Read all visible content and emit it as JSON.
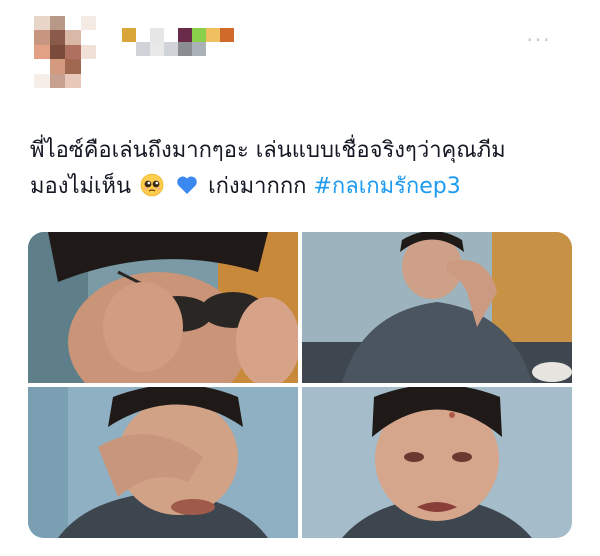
{
  "tweet": {
    "text_line1": "พี่ไอซ์คือเล่นถึงมากๆอะ เล่นแบบเชื่อจริงๆว่าคุณภีม",
    "text_line2_before": "มองไม่เห็น",
    "text_line2_after": "เก่งมากกก",
    "hashtag": "#กลเกมรักep3",
    "emojis": [
      "pleading-face",
      "blue-heart"
    ]
  },
  "colors": {
    "text": "#141823",
    "hashtag": "#1d9bf0",
    "avatar_pixels": [
      "#e8d6c8",
      "#b89988",
      "#ffffff",
      "#f4ece4",
      "#c89680",
      "#8a5a4a",
      "#d9b8a8",
      "#ffffff",
      "#e2a084",
      "#7a4a3a",
      "#b07060",
      "#f0e0d8",
      "#ffffff",
      "#d49a80",
      "#a06850",
      "#ffffff",
      "#f6eee8",
      "#c8a090",
      "#e8c8b8",
      "#ffffff"
    ],
    "name_pixels": [
      "#d9a63a",
      "#ffffff",
      "#e6e6e6",
      "#ffffff",
      "#6a2a4a",
      "#8ad04a",
      "#f0c060",
      "#d06a2a",
      "#ffffff",
      "#cfd3d8",
      "#e8e8e8",
      "#d0d4d8",
      "#8a8e92",
      "#aab2b8",
      "#ffffff",
      "#ffffff"
    ]
  },
  "media": {
    "images": [
      "man-removing-sunglasses",
      "man-hand-on-forehead",
      "man-covering-face-crying",
      "man-crying"
    ]
  }
}
